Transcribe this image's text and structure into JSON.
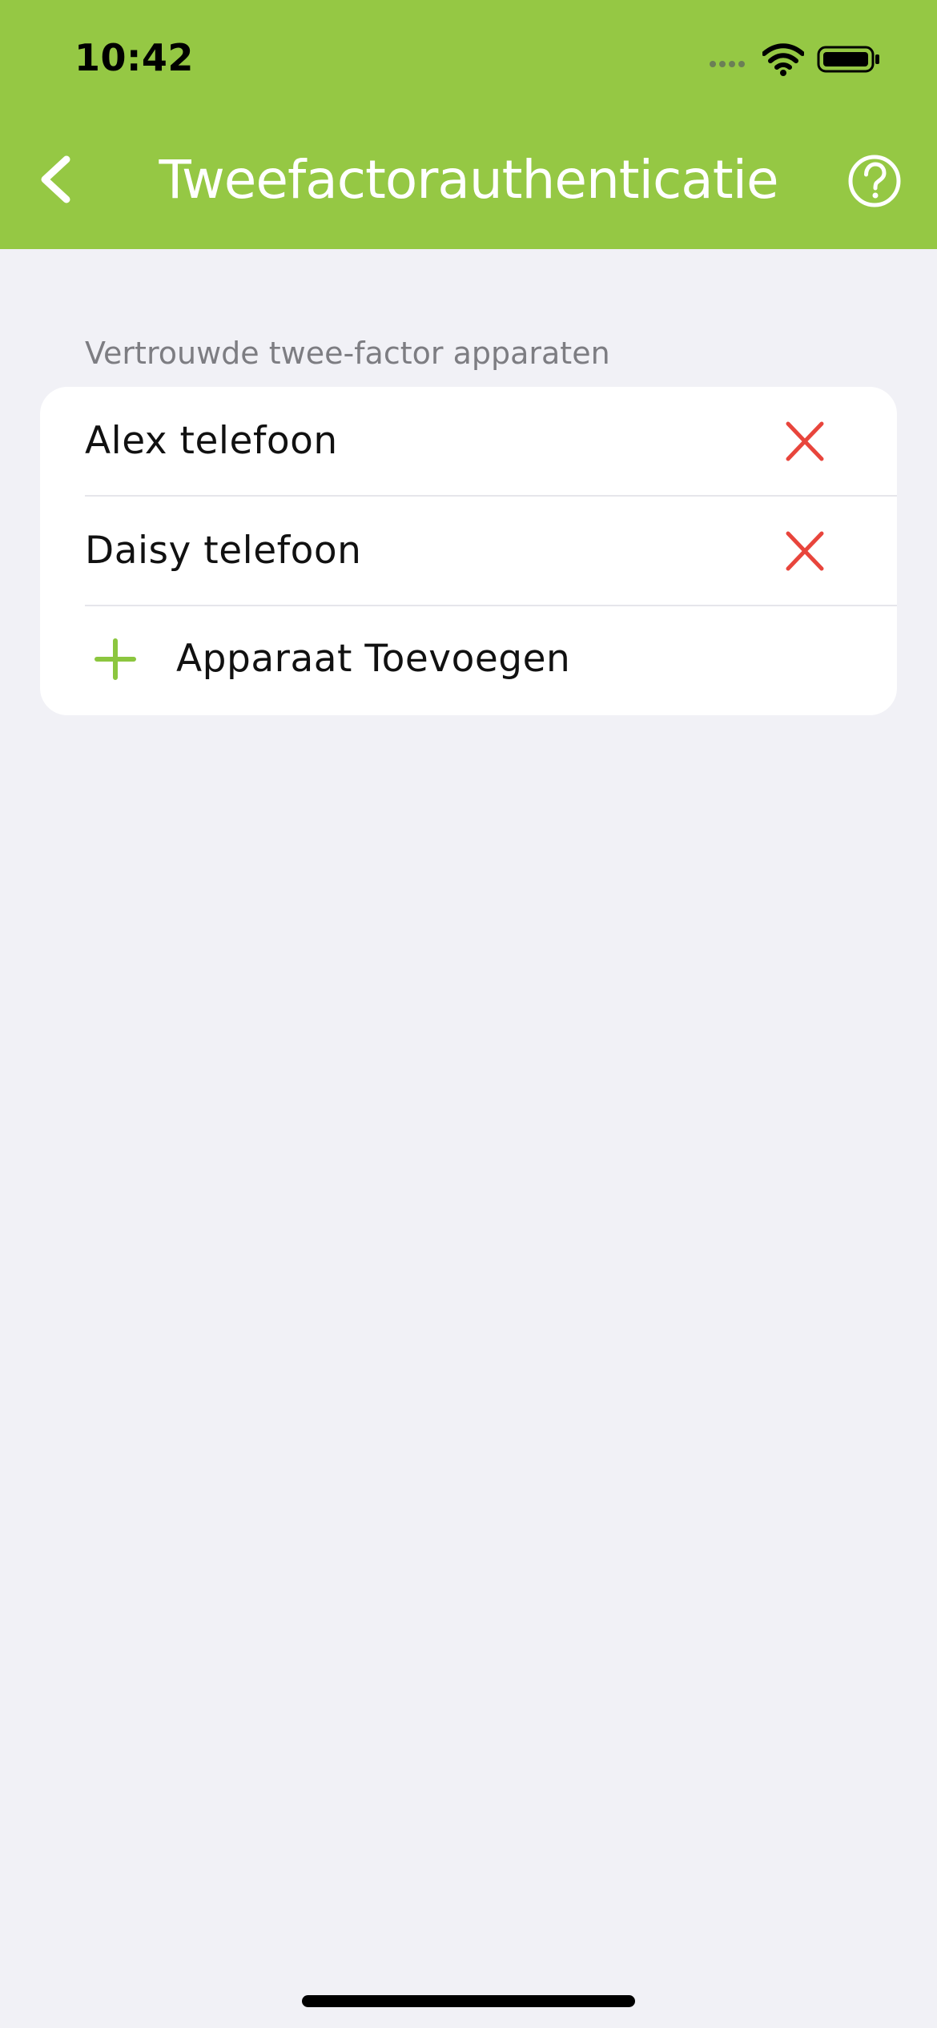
{
  "status_bar": {
    "time": "10:42",
    "icons": [
      "cellular-signal-icon",
      "wifi-icon",
      "battery-icon"
    ]
  },
  "nav": {
    "title": "Tweefactorauthenticatie",
    "back_icon": "chevron-left-icon",
    "help_icon": "question-circle-icon"
  },
  "section": {
    "title": "Vertrouwde twee-factor apparaten",
    "devices": [
      {
        "name": "Alex telefoon",
        "action_icon": "close-icon"
      },
      {
        "name": "Daisy telefoon",
        "action_icon": "close-icon"
      }
    ],
    "add_button": {
      "label": "Apparaat Toevoegen",
      "icon": "plus-icon"
    }
  },
  "colors": {
    "header_bg": "#95c844",
    "background": "#f1f1f6",
    "remove_red": "#e8453c",
    "add_green": "#8cc63f",
    "section_label": "#7d7d82"
  }
}
